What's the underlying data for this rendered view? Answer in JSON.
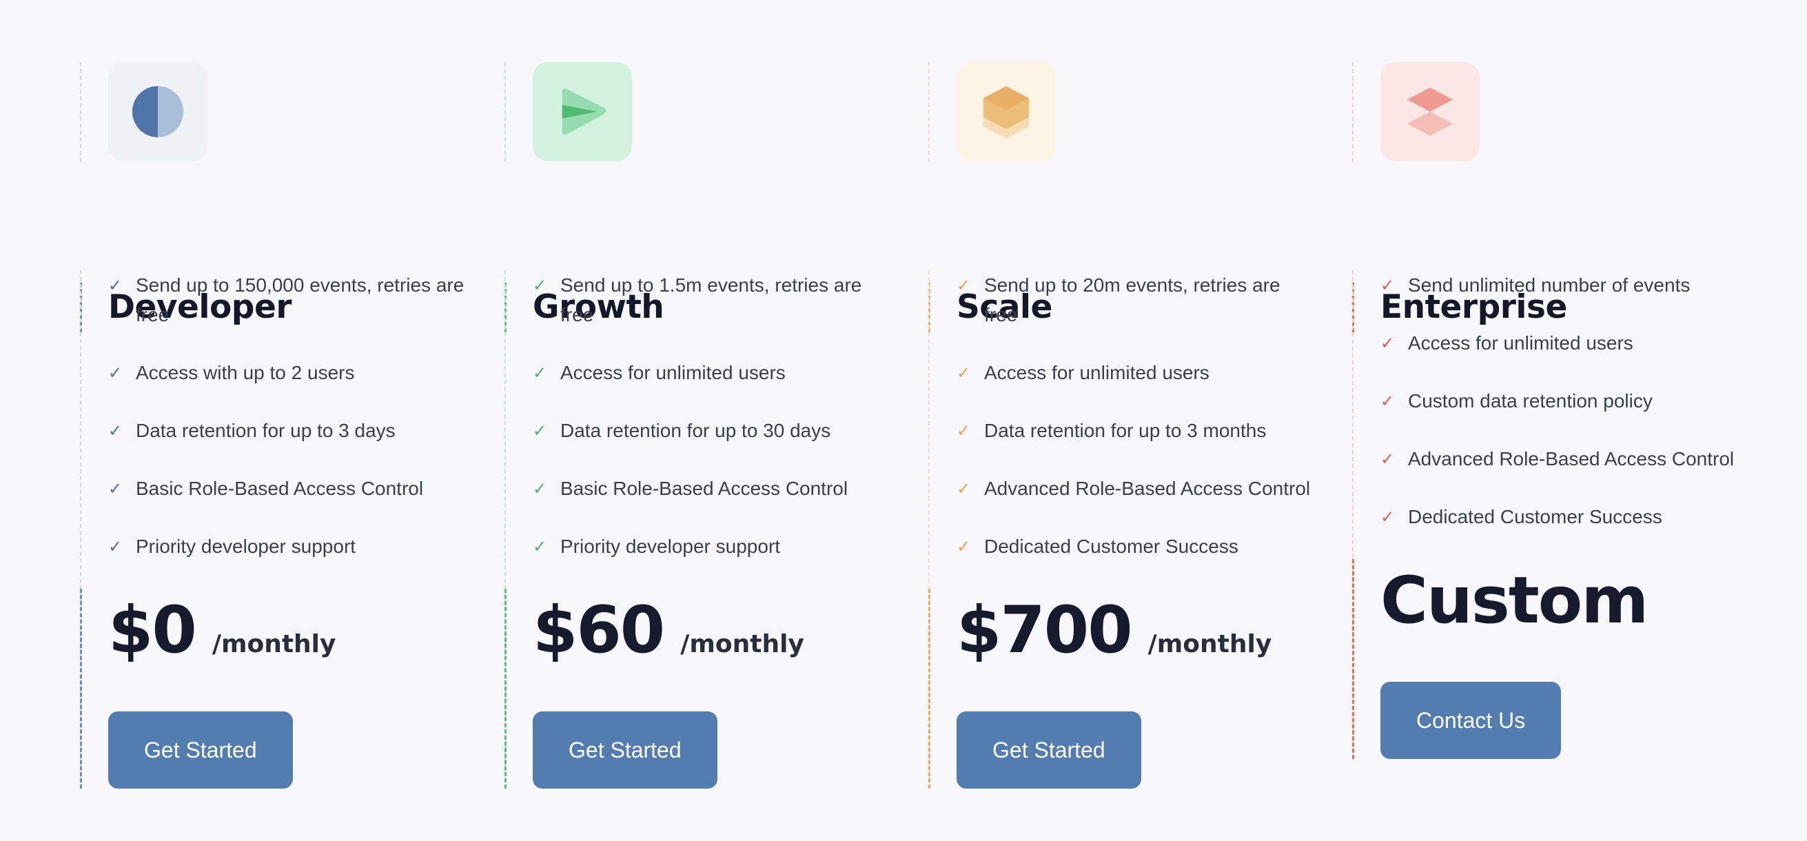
{
  "plans": [
    {
      "name": "Developer",
      "icon": "half-circle-icon",
      "features": [
        "Send up to 150,000 events, retries are free",
        "Access with up to 2 users",
        "Data retention for up to 3 days",
        "Basic Role-Based Access Control",
        "Priority developer support"
      ],
      "price": "$0",
      "period": "/monthly",
      "cta": "Get Started"
    },
    {
      "name": "Growth",
      "icon": "send-arrow-icon",
      "features": [
        "Send up to 1.5m events, retries are free",
        "Access for unlimited users",
        "Data retention for up to 30 days",
        "Basic Role-Based Access Control",
        "Priority developer support"
      ],
      "price": "$60",
      "period": "/monthly",
      "cta": "Get Started"
    },
    {
      "name": "Scale",
      "icon": "stacked-hexagon-icon",
      "features": [
        "Send up to 20m events, retries are free",
        "Access for unlimited users",
        "Data retention for up to 3 months",
        "Advanced Role-Based Access Control",
        "Dedicated Customer Success"
      ],
      "price": "$700",
      "period": "/monthly",
      "cta": "Get Started"
    },
    {
      "name": "Enterprise",
      "icon": "stacked-diamonds-icon",
      "features": [
        "Send unlimited number of events",
        "Access for unlimited users",
        "Custom data retention policy",
        "Advanced Role-Based Access Control",
        "Dedicated Customer Success"
      ],
      "price": "Custom",
      "period": "",
      "cta": "Contact Us"
    }
  ],
  "check_glyph": "✓",
  "colors": {
    "button": "#537cb0",
    "developer_accent": "#4d6f9b",
    "growth_accent": "#47b268",
    "scale_accent": "#eba24f",
    "enterprise_accent": "#e05c4b"
  }
}
